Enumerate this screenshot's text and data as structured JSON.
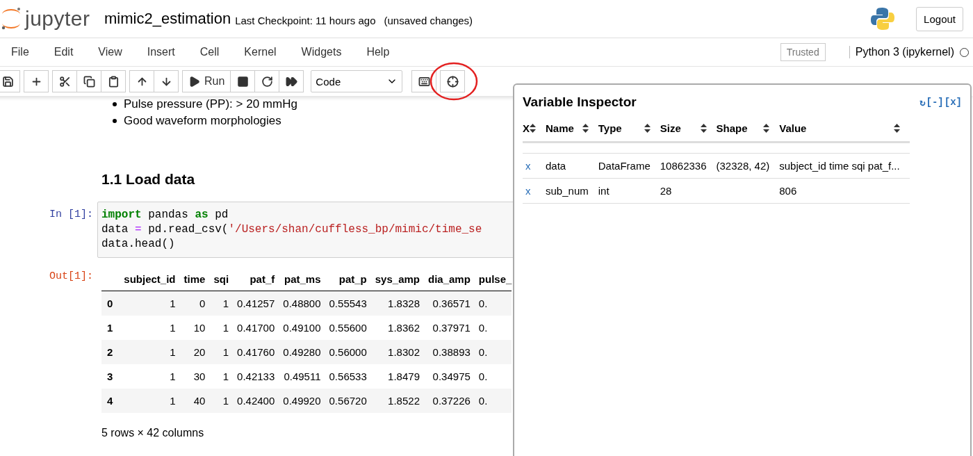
{
  "header": {
    "logo_text": "jupyter",
    "notebook_name": "mimic2_estimation",
    "checkpoint": "Last Checkpoint: 11 hours ago",
    "unsaved": "(unsaved changes)",
    "logout": "Logout"
  },
  "menu": [
    "File",
    "Edit",
    "View",
    "Insert",
    "Cell",
    "Kernel",
    "Widgets",
    "Help"
  ],
  "trusted": "Trusted",
  "kernel": {
    "name": "Python 3 (ipykernel)",
    "busy": false
  },
  "toolbar": {
    "groups": [
      [
        {
          "kind": "save"
        }
      ],
      [
        {
          "kind": "add"
        }
      ],
      [
        {
          "kind": "cut"
        },
        {
          "kind": "copy"
        },
        {
          "kind": "paste"
        }
      ],
      [
        {
          "kind": "up"
        },
        {
          "kind": "down"
        }
      ],
      [
        {
          "kind": "run",
          "label": "Run"
        },
        {
          "kind": "stop"
        },
        {
          "kind": "restart"
        },
        {
          "kind": "fast_forward"
        }
      ]
    ],
    "cell_type": "Code",
    "extra": [
      {
        "kind": "keyboard",
        "highlighted": false
      },
      {
        "kind": "crosshair",
        "highlighted": true
      }
    ]
  },
  "notebook": {
    "bullets": [
      "Pulse pressure (PP): > 20 mmHg",
      "Good waveform morphologies"
    ],
    "heading": "1.1 Load data",
    "input_prompt": "In [1]:",
    "code_lines": [
      [
        {
          "kind": "keyword",
          "text": "import"
        },
        {
          "kind": "plain",
          "text": " pandas "
        },
        {
          "kind": "keyword",
          "text": "as"
        },
        {
          "kind": "plain",
          "text": " pd"
        }
      ],
      [
        {
          "kind": "plain",
          "text": "data "
        },
        {
          "kind": "operator",
          "text": "="
        },
        {
          "kind": "plain",
          "text": " pd.read_csv("
        },
        {
          "kind": "string",
          "text": "'/Users/shan/cuffless_bp/mimic/time_se"
        }
      ],
      [
        {
          "kind": "plain",
          "text": "data.head()"
        }
      ]
    ],
    "output_prompt": "Out[1]:",
    "table": {
      "columns": [
        "subject_id",
        "time",
        "sqi",
        "pat_f",
        "pat_ms",
        "pat_p",
        "sys_amp",
        "dia_amp",
        "pulse_"
      ],
      "rows": [
        {
          "index": "0",
          "cells": [
            "1",
            "0",
            "1",
            "0.41257",
            "0.48800",
            "0.55543",
            "1.8328",
            "0.36571",
            "0."
          ]
        },
        {
          "index": "1",
          "cells": [
            "1",
            "10",
            "1",
            "0.41700",
            "0.49100",
            "0.55600",
            "1.8362",
            "0.37971",
            "0."
          ]
        },
        {
          "index": "2",
          "cells": [
            "1",
            "20",
            "1",
            "0.41760",
            "0.49280",
            "0.56000",
            "1.8302",
            "0.38893",
            "0."
          ]
        },
        {
          "index": "3",
          "cells": [
            "1",
            "30",
            "1",
            "0.42133",
            "0.49511",
            "0.56533",
            "1.8479",
            "0.34975",
            "0."
          ]
        },
        {
          "index": "4",
          "cells": [
            "1",
            "40",
            "1",
            "0.42400",
            "0.49920",
            "0.56720",
            "1.8522",
            "0.37226",
            "0."
          ]
        }
      ]
    },
    "footer": "5 rows × 42 columns"
  },
  "inspector": {
    "title": "Variable Inspector",
    "controls": [
      "↻",
      "[-]",
      "[x]"
    ],
    "columns": [
      "X",
      "Name",
      "Type",
      "Size",
      "Shape",
      "Value"
    ],
    "rows": [
      {
        "delete": "x",
        "name": "data",
        "type": "DataFrame",
        "size": "10862336",
        "shape": "(32328, 42)",
        "value": "subject_id time sqi pat_f..."
      },
      {
        "delete": "x",
        "name": "sub_num",
        "type": "int",
        "size": "28",
        "value": "806"
      }
    ]
  }
}
